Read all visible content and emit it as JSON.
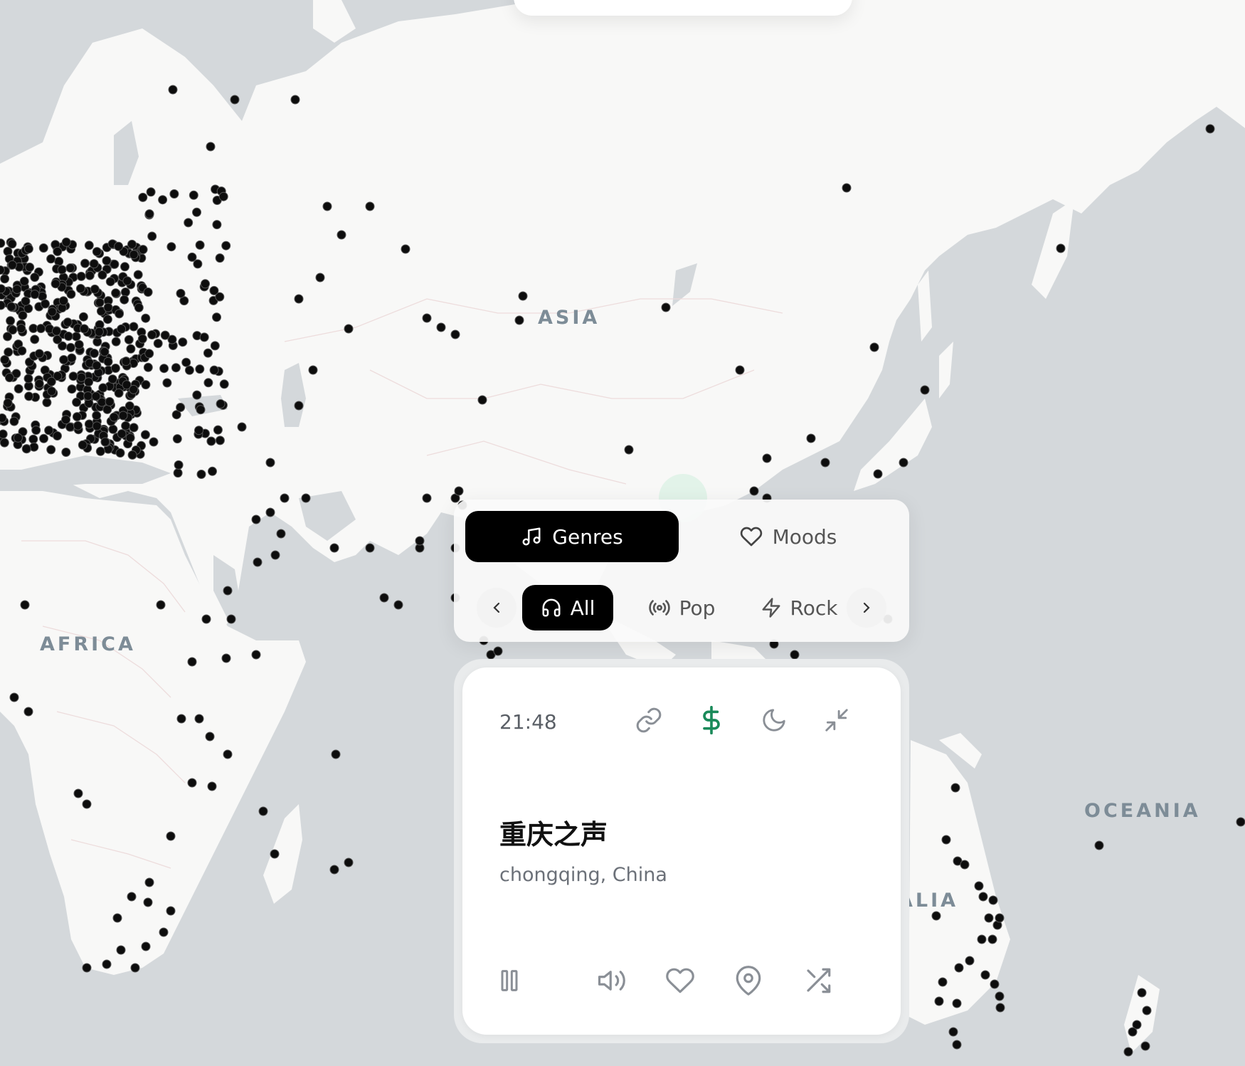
{
  "map": {
    "labels": {
      "asia": "ASIA",
      "africa": "AFRICA",
      "oceania": "OCEANIA",
      "australia_partial": "ALIA"
    },
    "colors": {
      "water": "#d4d8db",
      "land": "#f8f8f7",
      "station_dot": "#0d0d0d",
      "border": "#efe6e6"
    }
  },
  "genre_panel": {
    "modes": [
      {
        "label": "Genres",
        "icon": "music-note-icon",
        "active": true
      },
      {
        "label": "Moods",
        "icon": "heart-icon",
        "active": false
      }
    ],
    "chips": [
      {
        "label": "All",
        "icon": "headphones-icon",
        "active": true
      },
      {
        "label": "Pop",
        "icon": "broadcast-icon",
        "active": false
      },
      {
        "label": "Rock",
        "icon": "lightning-icon",
        "active": false
      }
    ],
    "prev_icon": "chevron-left-icon",
    "next_icon": "chevron-right-icon"
  },
  "player": {
    "time": "21:48",
    "station_name": "重庆之声",
    "location": "chongqing, China",
    "header_icons": [
      "link-icon",
      "dollar-icon",
      "moon-icon",
      "minimize-icon"
    ],
    "controls": [
      "pause-icon",
      "volume-icon",
      "heart-icon",
      "location-pin-icon",
      "shuffle-icon"
    ],
    "accent_color": "#1a8a5a"
  }
}
